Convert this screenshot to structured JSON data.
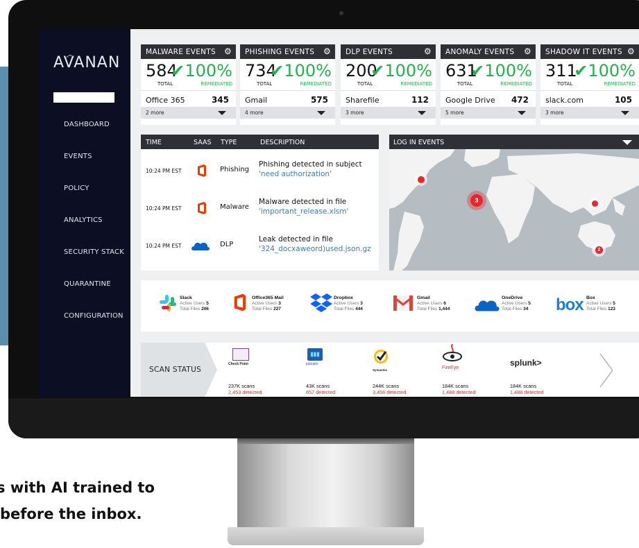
{
  "sidebar": {
    "logo": "AVANAN",
    "items": [
      {
        "label": "DASHBOARD"
      },
      {
        "label": "EVENTS"
      },
      {
        "label": "POLICY"
      },
      {
        "label": "ANALYTICS"
      },
      {
        "label": "SECURITY STACK"
      },
      {
        "label": "QUARANTINE"
      },
      {
        "label": "CONFIGURATION"
      }
    ]
  },
  "cards": [
    {
      "title": "MALWARE EVENTS",
      "total": "584",
      "total_label": "TOTAL",
      "pct": "100%",
      "pct_label": "REMEDIATED",
      "top_name": "Office 365",
      "top_value": "345",
      "more": "2 more"
    },
    {
      "title": "PHISHING EVENTS",
      "total": "734",
      "total_label": "TOTAL",
      "pct": "100%",
      "pct_label": "REMEDIATED",
      "top_name": "Gmail",
      "top_value": "575",
      "more": "4 more"
    },
    {
      "title": "DLP EVENTS",
      "total": "200",
      "total_label": "TOTAL",
      "pct": "100%",
      "pct_label": "REMEDIATED",
      "top_name": "Sharefile",
      "top_value": "112",
      "more": "3 more"
    },
    {
      "title": "ANOMALY EVENTS",
      "total": "631",
      "total_label": "TOTAL",
      "pct": "100%",
      "pct_label": "REMEDIATED",
      "top_name": "Google Drive",
      "top_value": "472",
      "more": "5 more"
    },
    {
      "title": "SHADOW IT EVENTS",
      "total": "311",
      "total_label": "TOTAL",
      "pct": "100%",
      "pct_label": "REMEDIATED",
      "top_name": "slack.com",
      "top_value": "105",
      "more": "3 more"
    }
  ],
  "events_table": {
    "columns": [
      "TIME",
      "SAAS",
      "TYPE",
      "DESCRIPTION"
    ],
    "rows": [
      {
        "time": "10:24 PM EST",
        "saas_icon": "office365-icon",
        "type": "Phishing",
        "desc": "Phishing detected in subject",
        "detail": "'need authorization'"
      },
      {
        "time": "10:24 PM EST",
        "saas_icon": "office365-icon",
        "type": "Malware",
        "desc": "Malware detected in file",
        "detail": "'important_release.xlsm'"
      },
      {
        "time": "10:24 PM EST",
        "saas_icon": "onedrive-icon",
        "type": "DLP",
        "desc": "Leak detected in file",
        "detail": "'324_docxaweord)used.json.gz"
      }
    ]
  },
  "map": {
    "title": "LOG IN EVENTS",
    "markers": [
      {
        "label": ""
      },
      {
        "label": "3"
      },
      {
        "label": ""
      },
      {
        "label": "2"
      }
    ]
  },
  "saas_apps": [
    {
      "name": "Slack",
      "users_label": "Active Users",
      "users": "5",
      "files_label": "Total Files",
      "files": "206"
    },
    {
      "name": "Office365 Mail",
      "users_label": "Active Users",
      "users": "3",
      "files_label": "Total Files",
      "files": "227"
    },
    {
      "name": "Dropbox",
      "users_label": "Active Users",
      "users": "3",
      "files_label": "Total Files",
      "files": "444"
    },
    {
      "name": "Gmail",
      "users_label": "Active Users",
      "users": "6",
      "files_label": "Total Files",
      "files": "1,444"
    },
    {
      "name": "OneDrive",
      "users_label": "Active Users",
      "users": "5",
      "files_label": "Total Files",
      "files": "34"
    },
    {
      "name": "Box",
      "users_label": "Active Users",
      "users": "5",
      "files_label": "Total Files",
      "files": "123"
    }
  ],
  "scan": {
    "label": "SCAN STATUS",
    "vendors": [
      {
        "logo": "Check Point",
        "scans": "237K scans",
        "detected": "2,453 detected"
      },
      {
        "logo": "paloalto",
        "scans": "43K scans",
        "detected": "657 detected"
      },
      {
        "logo": "Symantec",
        "scans": "244K scans",
        "detected": "3,456 detected"
      },
      {
        "logo": "FireEye",
        "scans": "184K scans",
        "detected": "1,488 detected"
      },
      {
        "logo": "splunk>",
        "scans": "184K scans",
        "detected": "1,488 detected"
      }
    ]
  },
  "caption": {
    "line1": "ts with AI trained to",
    "line2": "before the inbox."
  },
  "colors": {
    "accent_green": "#22b24c",
    "link_blue": "#3a7cc0",
    "marker_red": "#e8262c",
    "sidebar_bg": "#0c0e23"
  }
}
